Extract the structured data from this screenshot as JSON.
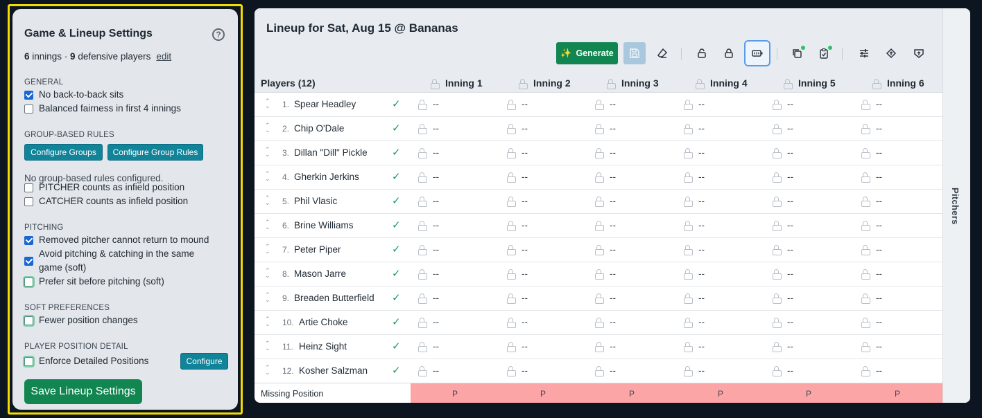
{
  "settings": {
    "title": "Game & Lineup Settings",
    "help_icon": "?",
    "summary": {
      "innings": "6",
      "innings_text": " innings · ",
      "players": "9",
      "players_text": " defensive players",
      "edit_label": "edit"
    },
    "general": {
      "label": "GENERAL",
      "options": [
        {
          "label": "No back-to-back sits",
          "checked": true
        },
        {
          "label": "Balanced fairness in first 4 innings",
          "checked": false
        }
      ]
    },
    "group_rules": {
      "label": "GROUP-BASED RULES",
      "configure_groups": "Configure Groups",
      "configure_group_rules": "Configure Group Rules",
      "note": "No group-based rules configured.",
      "options": [
        {
          "label": "PITCHER counts as infield position",
          "checked": false
        },
        {
          "label": "CATCHER counts as infield position",
          "checked": false
        }
      ]
    },
    "pitching": {
      "label": "PITCHING",
      "options": [
        {
          "label": "Removed pitcher cannot return to mound",
          "checked": true
        },
        {
          "label": "Avoid pitching & catching in the same game (soft)",
          "checked": true
        },
        {
          "label": "Prefer sit before pitching (soft)",
          "checked": false
        }
      ]
    },
    "soft_preferences": {
      "label": "SOFT PREFERENCES",
      "options": [
        {
          "label": "Fewer position changes",
          "checked": false
        }
      ]
    },
    "player_position_detail": {
      "label": "PLAYER POSITION DETAIL",
      "options": [
        {
          "label": "Enforce Detailed Positions",
          "checked": false
        }
      ],
      "configure_label": "Configure"
    },
    "save_label": "Save Lineup Settings"
  },
  "lineup": {
    "title": "Lineup for Sat, Aug 15 @ Bananas",
    "generate_label": "Generate",
    "players_header": "Players (12)",
    "innings": [
      "Inning 1",
      "Inning 2",
      "Inning 3",
      "Inning 4",
      "Inning 5",
      "Inning 6"
    ],
    "placeholder": "--",
    "players": [
      {
        "num": "1.",
        "name": "Spear Headley"
      },
      {
        "num": "2.",
        "name": "Chip O'Dale"
      },
      {
        "num": "3.",
        "name": "Dillan \"Dill\" Pickle"
      },
      {
        "num": "4.",
        "name": "Gherkin Jerkins"
      },
      {
        "num": "5.",
        "name": "Phil Vlasic"
      },
      {
        "num": "6.",
        "name": "Brine Williams"
      },
      {
        "num": "7.",
        "name": "Peter Piper"
      },
      {
        "num": "8.",
        "name": "Mason Jarre"
      },
      {
        "num": "9.",
        "name": "Breaden Butterfield"
      },
      {
        "num": "10.",
        "name": "Artie Choke"
      },
      {
        "num": "11.",
        "name": "Heinz Sight"
      },
      {
        "num": "12.",
        "name": "Kosher Salzman"
      }
    ],
    "check_mark": "✓",
    "missing_label": "Missing Position",
    "missing_values": [
      "P",
      "P",
      "P",
      "P",
      "P",
      "P"
    ],
    "side_tab": "Pitchers"
  },
  "colors": {
    "accent": "#128651",
    "teal": "#11849a",
    "missing": "#fca5a7",
    "highlight": "#f5dc00"
  }
}
